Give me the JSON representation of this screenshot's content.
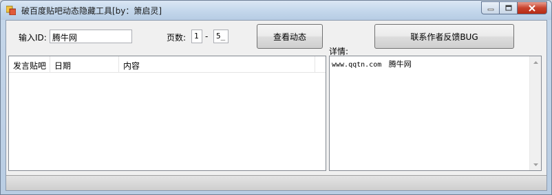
{
  "window": {
    "title": "破百度贴吧动态隐藏工具[by：箫启灵]"
  },
  "form": {
    "id_label": "输入ID:",
    "id_value": "腾牛网",
    "pages_label": "页数:",
    "page_from": "1",
    "page_sep": "-",
    "page_to": "5_",
    "view_button": "查看动态",
    "contact_button": "联系作者反馈BUG",
    "details_label": "详情:"
  },
  "list": {
    "columns": [
      "发言贴吧",
      "日期",
      "内容"
    ]
  },
  "details": {
    "url": "www.qqtn.com",
    "site_name": "腾牛网"
  }
}
